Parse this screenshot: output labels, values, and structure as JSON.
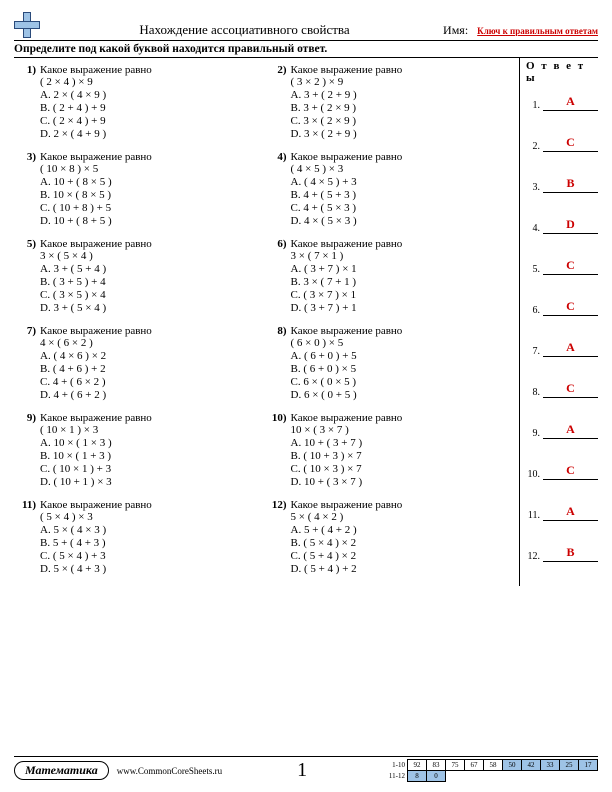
{
  "header": {
    "title": "Нахождение ассоциативного свойства",
    "name_label": "Имя:",
    "answer_key_label": "Ключ к правильным ответам"
  },
  "instruction": "Определите под какой буквой находится правильный ответ.",
  "answers_title": "О т в е т ы",
  "problems": [
    {
      "n": "1)",
      "q": "Какое выражение равно",
      "expr": "( 2 × 4 ) × 9",
      "opts": [
        "A. 2 × ( 4 × 9 )",
        "B. ( 2 + 4 ) + 9",
        "C. ( 2 × 4 ) + 9",
        "D. 2 × ( 4 + 9 )"
      ]
    },
    {
      "n": "2)",
      "q": "Какое выражение равно",
      "expr": "( 3 × 2 ) × 9",
      "opts": [
        "A. 3 + ( 2 + 9 )",
        "B. 3 + ( 2 × 9 )",
        "C. 3 × ( 2 × 9 )",
        "D. 3 × ( 2 + 9 )"
      ]
    },
    {
      "n": "3)",
      "q": "Какое выражение равно",
      "expr": "( 10 × 8 ) × 5",
      "opts": [
        "A. 10 + ( 8 × 5 )",
        "B. 10 × ( 8 × 5 )",
        "C. ( 10 + 8 ) + 5",
        "D. 10 + ( 8 + 5 )"
      ]
    },
    {
      "n": "4)",
      "q": "Какое выражение равно",
      "expr": "( 4 × 5 ) × 3",
      "opts": [
        "A. ( 4 × 5 ) + 3",
        "B. 4 + ( 5 + 3 )",
        "C. 4 + ( 5 × 3 )",
        "D. 4 × ( 5 × 3 )"
      ]
    },
    {
      "n": "5)",
      "q": "Какое выражение равно",
      "expr": "3 × ( 5 × 4 )",
      "opts": [
        "A. 3 + ( 5 + 4 )",
        "B. ( 3 + 5 ) + 4",
        "C. ( 3 × 5 ) × 4",
        "D. 3 + ( 5 × 4 )"
      ]
    },
    {
      "n": "6)",
      "q": "Какое выражение равно",
      "expr": "3 × ( 7 × 1 )",
      "opts": [
        "A. ( 3 + 7 ) × 1",
        "B. 3 × ( 7 + 1 )",
        "C. ( 3 × 7 ) × 1",
        "D. ( 3 + 7 ) + 1"
      ]
    },
    {
      "n": "7)",
      "q": "Какое выражение равно",
      "expr": "4 × ( 6 × 2 )",
      "opts": [
        "A. ( 4 × 6 ) × 2",
        "B. ( 4 + 6 ) + 2",
        "C. 4 + ( 6 × 2 )",
        "D. 4 + ( 6 + 2 )"
      ]
    },
    {
      "n": "8)",
      "q": "Какое выражение равно",
      "expr": "( 6 × 0 ) × 5",
      "opts": [
        "A. ( 6 + 0 ) + 5",
        "B. ( 6 + 0 ) × 5",
        "C. 6 × ( 0 × 5 )",
        "D. 6 × ( 0 + 5 )"
      ]
    },
    {
      "n": "9)",
      "q": "Какое выражение равно",
      "expr": "( 10 × 1 ) × 3",
      "opts": [
        "A. 10 × ( 1 × 3 )",
        "B. 10 × ( 1 + 3 )",
        "C. ( 10 × 1 ) + 3",
        "D. ( 10 + 1 ) × 3"
      ]
    },
    {
      "n": "10)",
      "q": "Какое выражение равно",
      "expr": "10 × ( 3 × 7 )",
      "opts": [
        "A. 10 + ( 3 + 7 )",
        "B. ( 10 + 3 ) × 7",
        "C. ( 10 × 3 ) × 7",
        "D. 10 + ( 3 × 7 )"
      ]
    },
    {
      "n": "11)",
      "q": "Какое выражение равно",
      "expr": "( 5 × 4 ) × 3",
      "opts": [
        "A. 5 × ( 4 × 3 )",
        "B. 5 + ( 4 + 3 )",
        "C. ( 5 × 4 ) + 3",
        "D. 5 × ( 4 + 3 )"
      ]
    },
    {
      "n": "12)",
      "q": "Какое выражение равно",
      "expr": "5 × ( 4 × 2 )",
      "opts": [
        "A. 5 + ( 4 + 2 )",
        "B. ( 5 × 4 ) × 2",
        "C. ( 5 + 4 ) × 2",
        "D. ( 5 + 4 ) + 2"
      ]
    }
  ],
  "answers": [
    {
      "n": "1.",
      "v": "A"
    },
    {
      "n": "2.",
      "v": "C"
    },
    {
      "n": "3.",
      "v": "B"
    },
    {
      "n": "4.",
      "v": "D"
    },
    {
      "n": "5.",
      "v": "C"
    },
    {
      "n": "6.",
      "v": "C"
    },
    {
      "n": "7.",
      "v": "A"
    },
    {
      "n": "8.",
      "v": "C"
    },
    {
      "n": "9.",
      "v": "A"
    },
    {
      "n": "10.",
      "v": "C"
    },
    {
      "n": "11.",
      "v": "A"
    },
    {
      "n": "12.",
      "v": "B"
    }
  ],
  "footer": {
    "subject": "Математика",
    "url": "www.CommonCoreSheets.ru",
    "page": "1",
    "score_rows": [
      {
        "lab": "1-10",
        "cells": [
          "92",
          "83",
          "75",
          "67",
          "58",
          "50",
          "42",
          "33",
          "25",
          "17"
        ],
        "shade": 5
      },
      {
        "lab": "11-12",
        "cells": [
          "8",
          "0"
        ],
        "shade": 0
      }
    ]
  }
}
